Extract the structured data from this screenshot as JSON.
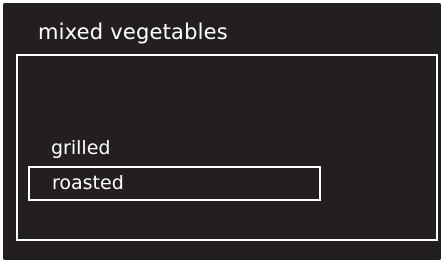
{
  "menu": {
    "title": "mixed vegetables",
    "options": [
      {
        "label": "grilled",
        "selected": false
      },
      {
        "label": "roasted",
        "selected": true
      }
    ]
  },
  "colors": {
    "background": "#231f20",
    "foreground": "#ffffff"
  }
}
